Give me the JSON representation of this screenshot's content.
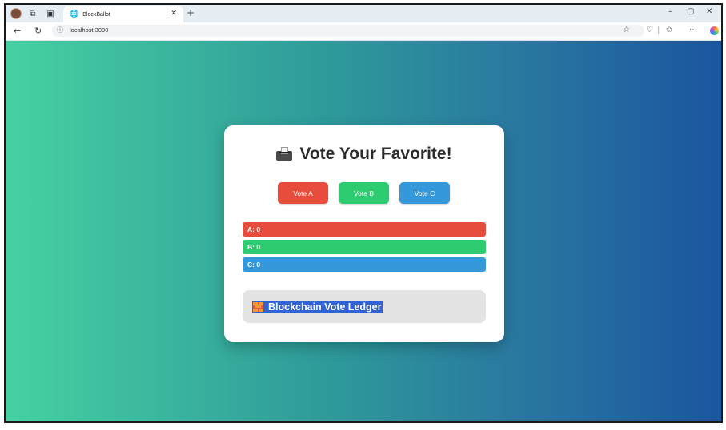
{
  "browser": {
    "tab_title": "BlockBallot",
    "url": "localhost:3000"
  },
  "page": {
    "heading": "Vote Your Favorite!",
    "buttons": [
      {
        "label": "Vote A",
        "color": "#e74c3c"
      },
      {
        "label": "Vote B",
        "color": "#2ecc71"
      },
      {
        "label": "Vote C",
        "color": "#3498db"
      }
    ],
    "tallies": [
      {
        "label": "A: 0",
        "count": 0,
        "color": "#e74c3c"
      },
      {
        "label": "B: 0",
        "count": 0,
        "color": "#2ecc71"
      },
      {
        "label": "C: 0",
        "count": 0,
        "color": "#3498db"
      }
    ],
    "ledger_title": "Blockchain Vote Ledger"
  }
}
